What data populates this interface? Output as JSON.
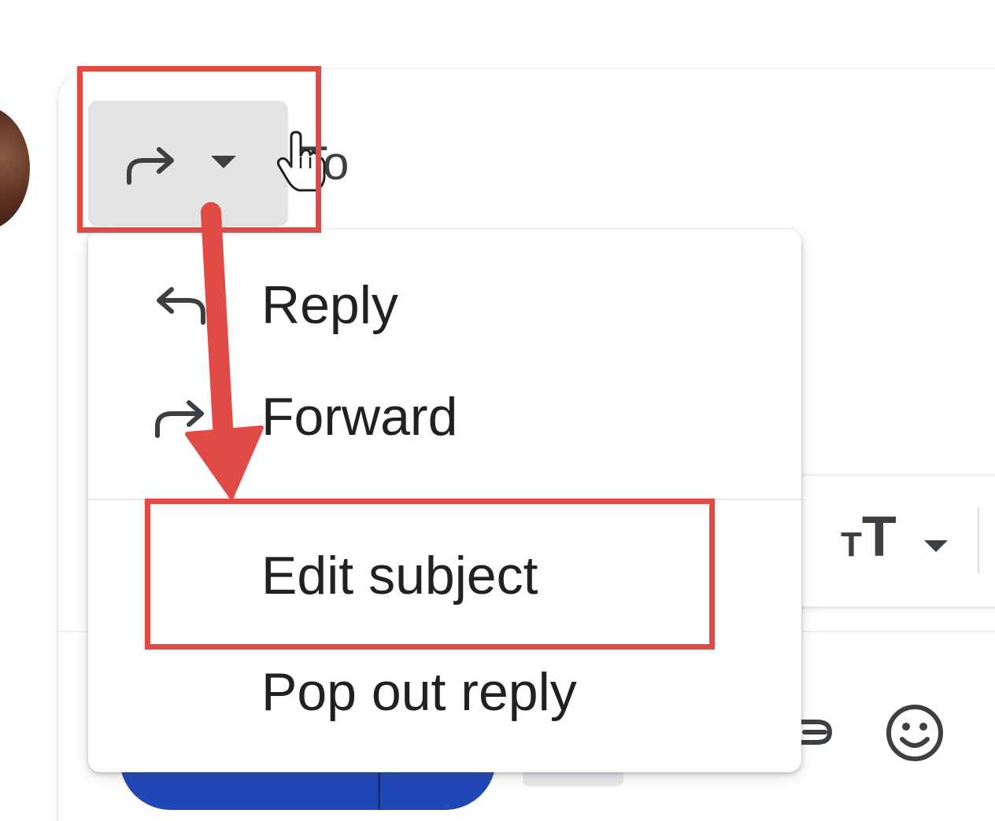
{
  "compose": {
    "to_label": "To",
    "reply_type_button": {
      "icon": "forward-arrow-icon",
      "caret": "chevron-down-icon"
    }
  },
  "dropdown_menu": {
    "items": [
      {
        "label": "Reply",
        "icon": "reply-icon"
      },
      {
        "label": "Forward",
        "icon": "forward-icon"
      },
      {
        "label": "Edit subject",
        "icon": ""
      },
      {
        "label": "Pop out reply",
        "icon": ""
      }
    ]
  },
  "format_toolbar": {
    "text_size_icon_small": "T",
    "text_size_icon_big": "T"
  },
  "bottom_bar": {
    "icons": [
      "insert-link-icon",
      "emoji-icon"
    ]
  },
  "colors": {
    "annotation_red": "#e04b45",
    "send_button_blue": "#2047b8",
    "button_gray": "#e4e4e4",
    "text_dark": "#202124"
  }
}
